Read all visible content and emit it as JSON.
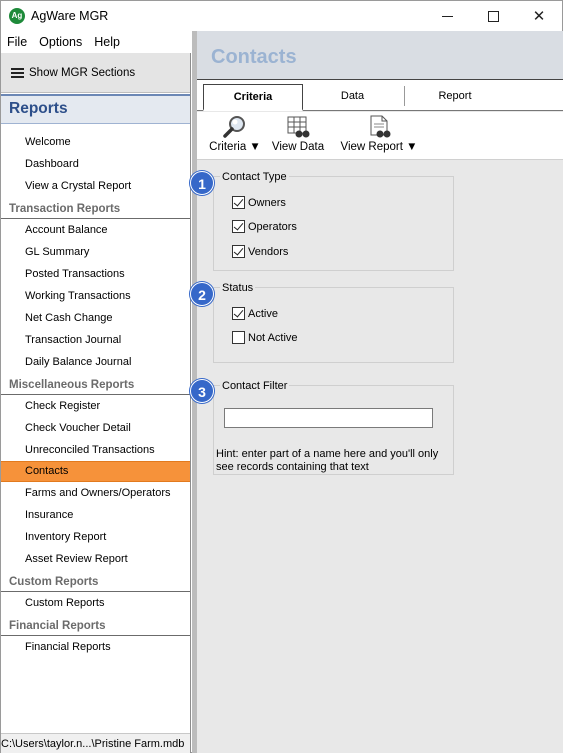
{
  "window": {
    "title": "AgWare MGR"
  },
  "menu": {
    "items": [
      "File",
      "Options",
      "Help"
    ]
  },
  "sidebar": {
    "show_sections": "Show MGR Sections",
    "header": "Reports",
    "items": [
      {
        "type": "item",
        "label": "Welcome"
      },
      {
        "type": "item",
        "label": "Dashboard"
      },
      {
        "type": "item",
        "label": "View a Crystal Report"
      },
      {
        "type": "section",
        "label": "Transaction Reports"
      },
      {
        "type": "item",
        "label": "Account Balance"
      },
      {
        "type": "item",
        "label": "GL Summary"
      },
      {
        "type": "item",
        "label": "Posted Transactions"
      },
      {
        "type": "item",
        "label": "Working Transactions"
      },
      {
        "type": "item",
        "label": "Net Cash Change"
      },
      {
        "type": "item",
        "label": "Transaction Journal"
      },
      {
        "type": "item",
        "label": "Daily Balance Journal"
      },
      {
        "type": "section",
        "label": "Miscellaneous Reports"
      },
      {
        "type": "item",
        "label": "Check Register"
      },
      {
        "type": "item",
        "label": "Check Voucher Detail"
      },
      {
        "type": "item",
        "label": "Unreconciled Transactions"
      },
      {
        "type": "item",
        "label": "Contacts",
        "active": true
      },
      {
        "type": "item",
        "label": "Farms and Owners/Operators"
      },
      {
        "type": "item",
        "label": "Insurance"
      },
      {
        "type": "item",
        "label": "Inventory Report"
      },
      {
        "type": "item",
        "label": "Asset Review Report"
      },
      {
        "type": "section",
        "label": "Custom Reports"
      },
      {
        "type": "item",
        "label": "Custom Reports"
      },
      {
        "type": "section",
        "label": "Financial Reports"
      },
      {
        "type": "item",
        "label": "Financial Reports"
      }
    ],
    "status_path": "C:\\Users\\taylor.n...\\Pristine Farm.mdb"
  },
  "main": {
    "title": "Contacts",
    "tabs": {
      "criteria": "Criteria",
      "data": "Data",
      "report": "Report"
    },
    "toolbar": {
      "criteria": "Criteria ▼",
      "view_data": "View Data",
      "view_report": "View Report ▼"
    },
    "contact_type": {
      "legend": "Contact Type",
      "owners": "Owners",
      "operators": "Operators",
      "vendors": "Vendors"
    },
    "status": {
      "legend": "Status",
      "active": "Active",
      "not_active": "Not Active"
    },
    "contact_filter": {
      "legend": "Contact Filter",
      "value": "",
      "hint": "Hint: enter part of a name here and you'll only see records containing that text"
    },
    "badges": [
      "1",
      "2",
      "3"
    ]
  },
  "colors": {
    "active_nav": "#f6923a",
    "header_text": "#2d4f8a",
    "badge": "#3668c9",
    "title_text": "#9bb3d2"
  }
}
